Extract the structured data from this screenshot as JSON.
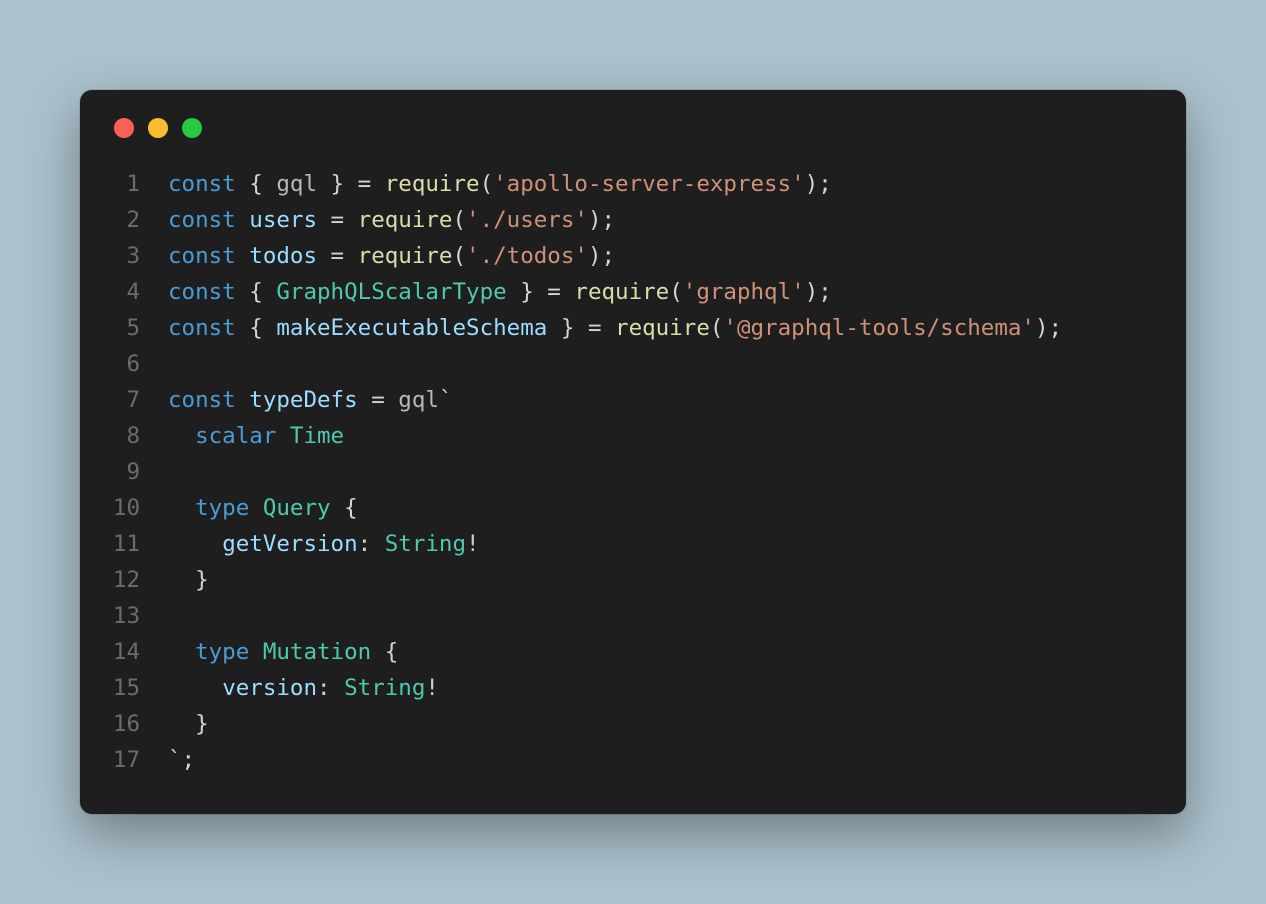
{
  "window": {
    "controls": [
      "close",
      "minimize",
      "zoom"
    ]
  },
  "code": {
    "lines": [
      {
        "n": "1",
        "tokens": [
          {
            "c": "tok-kw",
            "t": "const"
          },
          {
            "c": "tok-punc",
            "t": " { "
          },
          {
            "c": "tok-ident",
            "t": "gql"
          },
          {
            "c": "tok-punc",
            "t": " } = "
          },
          {
            "c": "tok-fn",
            "t": "require"
          },
          {
            "c": "tok-punc",
            "t": "("
          },
          {
            "c": "tok-str",
            "t": "'apollo-server-express'"
          },
          {
            "c": "tok-punc",
            "t": ");"
          }
        ]
      },
      {
        "n": "2",
        "tokens": [
          {
            "c": "tok-kw",
            "t": "const"
          },
          {
            "c": "tok-punc",
            "t": " "
          },
          {
            "c": "tok-var",
            "t": "users"
          },
          {
            "c": "tok-punc",
            "t": " = "
          },
          {
            "c": "tok-fn",
            "t": "require"
          },
          {
            "c": "tok-punc",
            "t": "("
          },
          {
            "c": "tok-str",
            "t": "'./users'"
          },
          {
            "c": "tok-punc",
            "t": ");"
          }
        ]
      },
      {
        "n": "3",
        "tokens": [
          {
            "c": "tok-kw",
            "t": "const"
          },
          {
            "c": "tok-punc",
            "t": " "
          },
          {
            "c": "tok-var",
            "t": "todos"
          },
          {
            "c": "tok-punc",
            "t": " = "
          },
          {
            "c": "tok-fn",
            "t": "require"
          },
          {
            "c": "tok-punc",
            "t": "("
          },
          {
            "c": "tok-str",
            "t": "'./todos'"
          },
          {
            "c": "tok-punc",
            "t": ");"
          }
        ]
      },
      {
        "n": "4",
        "tokens": [
          {
            "c": "tok-kw",
            "t": "const"
          },
          {
            "c": "tok-punc",
            "t": " { "
          },
          {
            "c": "tok-type",
            "t": "GraphQLScalarType"
          },
          {
            "c": "tok-punc",
            "t": " } = "
          },
          {
            "c": "tok-fn",
            "t": "require"
          },
          {
            "c": "tok-punc",
            "t": "("
          },
          {
            "c": "tok-str",
            "t": "'graphql'"
          },
          {
            "c": "tok-punc",
            "t": ");"
          }
        ]
      },
      {
        "n": "5",
        "tokens": [
          {
            "c": "tok-kw",
            "t": "const"
          },
          {
            "c": "tok-punc",
            "t": " { "
          },
          {
            "c": "tok-var",
            "t": "makeExecutableSchema"
          },
          {
            "c": "tok-punc",
            "t": " } = "
          },
          {
            "c": "tok-fn",
            "t": "require"
          },
          {
            "c": "tok-punc",
            "t": "("
          },
          {
            "c": "tok-str",
            "t": "'@graphql-tools/schema'"
          },
          {
            "c": "tok-punc",
            "t": ");"
          }
        ]
      },
      {
        "n": "6",
        "tokens": []
      },
      {
        "n": "7",
        "tokens": [
          {
            "c": "tok-kw",
            "t": "const"
          },
          {
            "c": "tok-punc",
            "t": " "
          },
          {
            "c": "tok-var",
            "t": "typeDefs"
          },
          {
            "c": "tok-punc",
            "t": " = "
          },
          {
            "c": "tok-ident",
            "t": "gql"
          },
          {
            "c": "tok-punc",
            "t": "`"
          }
        ]
      },
      {
        "n": "8",
        "tokens": [
          {
            "c": "tok-punc",
            "t": "  "
          },
          {
            "c": "tok-kw",
            "t": "scalar"
          },
          {
            "c": "tok-punc",
            "t": " "
          },
          {
            "c": "tok-type",
            "t": "Time"
          }
        ]
      },
      {
        "n": "9",
        "tokens": []
      },
      {
        "n": "10",
        "tokens": [
          {
            "c": "tok-punc",
            "t": "  "
          },
          {
            "c": "tok-kw",
            "t": "type"
          },
          {
            "c": "tok-punc",
            "t": " "
          },
          {
            "c": "tok-type",
            "t": "Query"
          },
          {
            "c": "tok-punc",
            "t": " {"
          }
        ]
      },
      {
        "n": "11",
        "tokens": [
          {
            "c": "tok-punc",
            "t": "    "
          },
          {
            "c": "tok-var",
            "t": "getVersion"
          },
          {
            "c": "tok-punc",
            "t": ": "
          },
          {
            "c": "tok-type",
            "t": "String"
          },
          {
            "c": "tok-ex",
            "t": "!"
          }
        ]
      },
      {
        "n": "12",
        "tokens": [
          {
            "c": "tok-punc",
            "t": "  }"
          }
        ]
      },
      {
        "n": "13",
        "tokens": []
      },
      {
        "n": "14",
        "tokens": [
          {
            "c": "tok-punc",
            "t": "  "
          },
          {
            "c": "tok-kw",
            "t": "type"
          },
          {
            "c": "tok-punc",
            "t": " "
          },
          {
            "c": "tok-type",
            "t": "Mutation"
          },
          {
            "c": "tok-punc",
            "t": " {"
          }
        ]
      },
      {
        "n": "15",
        "tokens": [
          {
            "c": "tok-punc",
            "t": "    "
          },
          {
            "c": "tok-var",
            "t": "version"
          },
          {
            "c": "tok-punc",
            "t": ": "
          },
          {
            "c": "tok-type",
            "t": "String"
          },
          {
            "c": "tok-ex",
            "t": "!"
          }
        ]
      },
      {
        "n": "16",
        "tokens": [
          {
            "c": "tok-punc",
            "t": "  }"
          }
        ]
      },
      {
        "n": "17",
        "tokens": [
          {
            "c": "tok-punc",
            "t": "`;"
          }
        ]
      }
    ]
  }
}
